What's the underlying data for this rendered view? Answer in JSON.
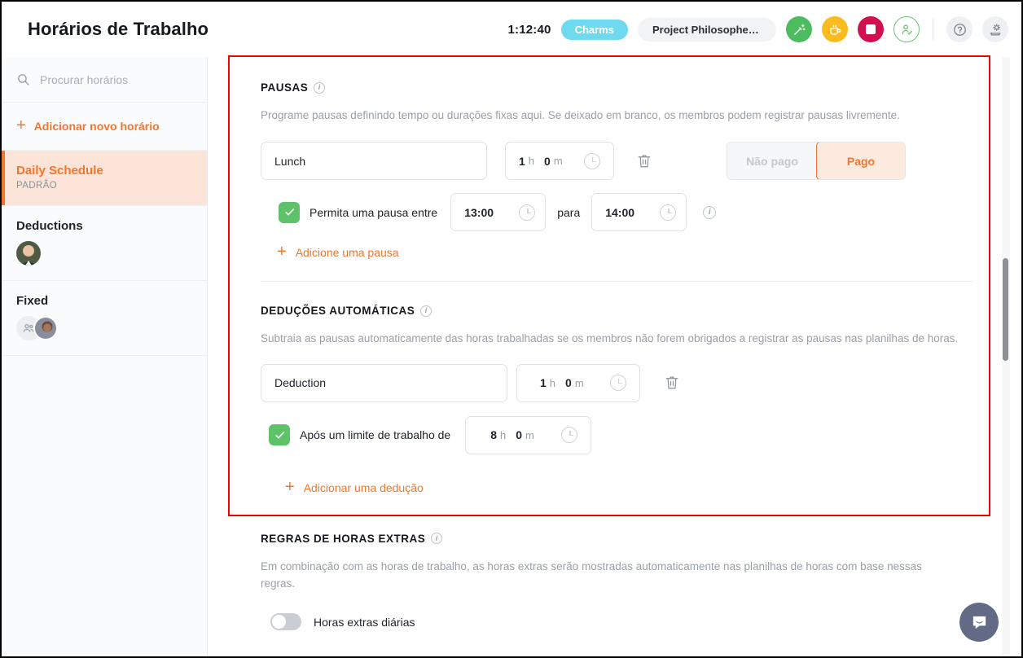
{
  "header": {
    "title": "Horários de Trabalho",
    "timer": "1:12:40",
    "charms_label": "Charms",
    "project_label": "Project Philosopher's S...",
    "icons": {
      "task": "magic-wand-icon",
      "break": "coffee-cup-icon",
      "stop": "stop-square-icon",
      "approve": "person-check-icon",
      "help": "question-mark-icon",
      "settings": "gear-hand-icon"
    }
  },
  "sidebar": {
    "search_placeholder": "Procurar horários",
    "search_value": "",
    "add_label": "Adicionar novo horário",
    "items": [
      {
        "name": "Daily Schedule",
        "sub": "PADRÃO",
        "active": true
      },
      {
        "name": "Deductions",
        "sub": "",
        "active": false
      },
      {
        "name": "Fixed",
        "sub": "",
        "active": false
      }
    ]
  },
  "main": {
    "breaks": {
      "title": "PAUSAS",
      "description": "Programe pausas definindo tempo ou durações fixas aqui. Se deixado em branco, os membros podem registrar pausas livremente.",
      "rows": [
        {
          "name_value": "Lunch",
          "hours": "1",
          "hours_unit": "h",
          "minutes": "0",
          "minutes_unit": "m",
          "unpaid_label": "Não pago",
          "paid_label": "Pago",
          "paid_selected": true,
          "window_checked": true,
          "window_label": "Permita uma pausa entre",
          "window_from": "13:00",
          "window_separator": "para",
          "window_to": "14:00"
        }
      ],
      "add_label": "Adicione uma pausa"
    },
    "deductions": {
      "title": "DEDUÇÕES AUTOMÁTICAS",
      "description": "Subtraia as pausas automaticamente das horas trabalhadas se os membros não forem obrigados a registrar as pausas nas planilhas de horas.",
      "rows": [
        {
          "name_value": "Deduction",
          "hours": "1",
          "hours_unit": "h",
          "minutes": "0",
          "minutes_unit": "m",
          "threshold_checked": true,
          "threshold_label": "Após um limite de trabalho de",
          "threshold_hours": "8",
          "threshold_hours_unit": "h",
          "threshold_minutes": "0",
          "threshold_minutes_unit": "m"
        }
      ],
      "add_label": "Adicionar uma dedução"
    },
    "overtime": {
      "title": "REGRAS DE HORAS EXTRAS",
      "description": "Em combinação com as horas de trabalho, as horas extras serão mostradas automaticamente nas planilhas de horas com base nessas regras.",
      "daily_toggle_label": "Horas extras diárias",
      "daily_toggle_on": false
    }
  },
  "colors": {
    "accent_orange": "#f2762e",
    "green": "#5ec269",
    "amber": "#f9bb1d",
    "crimson": "#d2104e",
    "cyan": "#6fd9ef",
    "annotation_red": "#f40000"
  }
}
